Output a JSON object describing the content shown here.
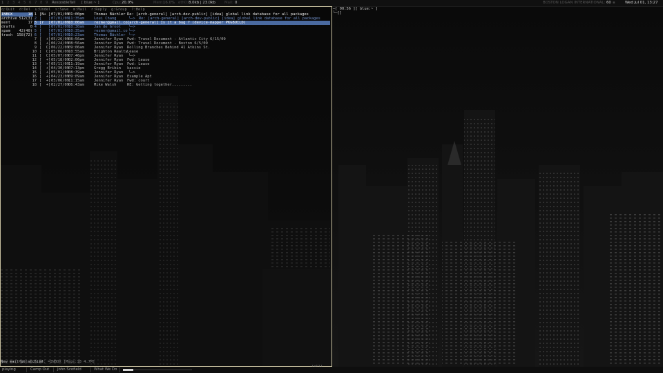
{
  "topbar": {
    "tags": [
      "1",
      "2",
      "3",
      "4",
      "5",
      "6",
      "7",
      "8",
      "9"
    ],
    "active_tag": "1",
    "layout": "ResizableTall",
    "window_title": "[ blue:~ ]",
    "cpu_label": "Cpu:",
    "cpu_value": "20.0%",
    "mem_label": "Mem:",
    "mem_value": "16.0%",
    "eth_label": "eth0:",
    "eth_value": "8.0kb | 23.0kb",
    "mail_label": "Mail:",
    "mail_value": "0",
    "weather_label": "BOSTON LOGAN INTERNATIONAL:",
    "weather_value": "60",
    "clock": "Wed Jul 01, 13:27"
  },
  "mutt": {
    "help_line": "q:Quit  d:Del  u:Undel  s:Save  m:Mail  r:Reply  g:Group  ?:Help",
    "folders": [
      {
        "name": "INBOX",
        "count": "18",
        "selected": true
      },
      {
        "name": "archive",
        "count": "512(3)",
        "selected": false
      },
      {
        "name": "ment",
        "count": "17",
        "selected": false
      },
      {
        "name": "drafts",
        "count": "0",
        "selected": false
      },
      {
        "name": "spam",
        "count": "42(40)",
        "selected": false
      },
      {
        "name": "trash",
        "count": "158(72)",
        "selected": false
      }
    ],
    "messages": [
      {
        "num": "1",
        "flags": "[N+ ]",
        "date": "07/01/09",
        "time": "01:00pm",
        "from": "Thomas Bächler",
        "tree": "",
        "subject": "Re: [arch-general] [arch-dev-public] [idea] global link database for all packages",
        "style": "new"
      },
      {
        "num": "2",
        "flags": "[   ]",
        "date": "07/01/09",
        "time": "11:35am",
        "from": "Loui Chang",
        "tree": "└─>",
        "subject": "Re: [arch-general] [arch-dev-public] [idea] global link database for all packages",
        "style": "thread"
      },
      {
        "num": "3",
        "flags": "[r  ]",
        "date": "07/01/09",
        "time": "10:00am",
        "from": "rezmer@gmail.co",
        "tree": "",
        "subject": "[arch-general] Is it a bug ? (device-mapper PKGBUILD)",
        "style": "current"
      },
      {
        "num": "4",
        "flags": "[   ]",
        "date": "07/01/09",
        "time": "10:30am",
        "from": "Jan de Groot",
        "tree": "└─>",
        "subject": "",
        "style": "thread"
      },
      {
        "num": "5",
        "flags": "[   ]",
        "date": "07/01/09",
        "time": "10:35am",
        "from": "rezmer@gmail.co",
        "tree": "└─>",
        "subject": "",
        "style": "thread"
      },
      {
        "num": "6",
        "flags": "[   ]",
        "date": "07/01/09",
        "time": "10:23am",
        "from": "Thomas Bächler",
        "tree": "└─>",
        "subject": "",
        "style": "thread"
      },
      {
        "num": "7",
        "flags": "[  +]",
        "date": "05/26/09",
        "time": "08:56am",
        "from": "Jennifer Ryan",
        "tree": "",
        "subject": "Fwd: Travel Document - Atlantic City 6/15/09",
        "style": "normal"
      },
      {
        "num": "8",
        "flags": "[  +]",
        "date": "06/24/09",
        "time": "08:56am",
        "from": "Jennifer Ryan",
        "tree": "",
        "subject": "Fwd: Travel Document - Boston 6/5/09",
        "style": "normal"
      },
      {
        "num": "9",
        "flags": "[  C]",
        "date": "06/22/09",
        "time": "09:06am",
        "from": "Jennifer Ryan",
        "tree": "",
        "subject": "Rolling Branches Behind 41 Atkins St.",
        "style": "normal"
      },
      {
        "num": "10",
        "flags": "[  C]",
        "date": "05/06/09",
        "time": "10:55am",
        "from": "Brighton Realty",
        "tree": "",
        "subject": "Lease",
        "style": "normal"
      },
      {
        "num": "11",
        "flags": "[  C]",
        "date": "05/07/09",
        "time": "07:46pm",
        "from": "Jennifer Ryan",
        "tree": "└─>",
        "subject": "",
        "style": "normal"
      },
      {
        "num": "12",
        "flags": "[  +]",
        "date": "05/18/09",
        "time": "02:06pm",
        "from": "Jennifer Ryan",
        "tree": "",
        "subject": "Fwd: Lease",
        "style": "normal"
      },
      {
        "num": "13",
        "flags": "[  +]",
        "date": "05/11/09",
        "time": "11:19am",
        "from": "Jennifer Ryan",
        "tree": "",
        "subject": "Fwd: Lease",
        "style": "normal"
      },
      {
        "num": "14",
        "flags": "[  +]",
        "date": "04/30/09",
        "time": "07:13pm",
        "from": "Gregg Bribin",
        "tree": "",
        "subject": "kassie",
        "style": "normal"
      },
      {
        "num": "15",
        "flags": "[  +]",
        "date": "05/01/09",
        "time": "08:39am",
        "from": "Jennifer Ryan",
        "tree": "└─>",
        "subject": "",
        "style": "normal"
      },
      {
        "num": "16",
        "flags": "[  +]",
        "date": "04/23/09",
        "time": "09:09am",
        "from": "Jennifer Ryan",
        "tree": "",
        "subject": "Example Apt",
        "style": "normal"
      },
      {
        "num": "17",
        "flags": "[  +]",
        "date": "03/06/09",
        "time": "11:15am",
        "from": "Jennifer Ryan",
        "tree": "",
        "subject": "Fwd: court",
        "style": "normal"
      },
      {
        "num": "18",
        "flags": "[  +]",
        "date": "02/27/09",
        "time": "06:43am",
        "from": "Mike Walsh",
        "tree": "",
        "subject": "RE: Getting together.........",
        "style": "normal"
      }
    ],
    "index_status": "--- Mutt 1.5.17: =INBOX [Msgs:18 4.7M]",
    "index_status_right": "(all)",
    "message_line": "New mail in archive"
  },
  "shell": {
    "prompt": "─[ 00:56 ][ blue:~ ]",
    "cursor": "└─[]"
  },
  "statusbar": {
    "state": "playing",
    "track": "Camp Out",
    "artist": "John Scofield",
    "album": "What We Do",
    "progress": 0.15
  },
  "colors": {
    "accent": "#c9c1a0",
    "selected_bg": "#4a6aa0",
    "thread_blue": "#6f8fc8",
    "new_text": "#e6e6e6"
  }
}
